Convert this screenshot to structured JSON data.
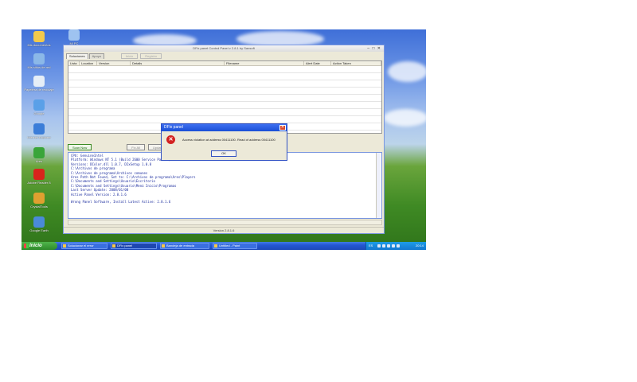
{
  "desktop": {
    "icons": [
      {
        "label": "Mis documentos",
        "icon": "documents-icon",
        "color": "#f2c94c"
      },
      {
        "label": "Mi PC",
        "icon": "computer-icon",
        "color": "#9ec3f0"
      },
      {
        "label": "Mis sitios de red",
        "icon": "network-icon",
        "color": "#8bb8e8"
      },
      {
        "label": "Papelera de reciclaje",
        "icon": "recycle-bin-icon",
        "color": "#e6eef7"
      },
      {
        "label": "Google",
        "icon": "browser-icon",
        "color": "#5aa0e8"
      },
      {
        "label": "Internet Explorer",
        "icon": "internet-explorer-icon",
        "color": "#3b7dd8"
      },
      {
        "label": "Ares",
        "icon": "ares-icon",
        "color": "#3aa53a"
      },
      {
        "label": "Adobe Reader 8",
        "icon": "adobe-reader-icon",
        "color": "#d8241c"
      },
      {
        "label": "CrystalTools",
        "icon": "tools-icon",
        "color": "#e0a030"
      },
      {
        "label": "Google Earth",
        "icon": "google-earth-icon",
        "color": "#4a8ad8"
      }
    ]
  },
  "app": {
    "title": "DFix panel Control Panel v 2.8.1 by Sansoft",
    "tabs": [
      {
        "label": "Soluciones"
      },
      {
        "label": "Apoyo"
      }
    ],
    "toolbar_buttons": [
      "Inicio",
      "Registro"
    ],
    "columns": [
      "Lista",
      "Location",
      "Version",
      "Details",
      "Filename",
      "Alert Date",
      "Action Taken"
    ],
    "actions": {
      "scan": "Scan Now",
      "fix": "Fix All",
      "update": "Update Now"
    },
    "log_lines": [
      "CPU: GenuineIntel",
      "Platform: Windows NT 5.1 (Build 2600 Service Pack 2)",
      "Versions: DColor.dll 1.0.7, DIxSetup 1.0.8",
      "C:\\Archivos de programa",
      "C:\\Archivos de programa\\Archivos comunes",
      "Ares Path Not Found, Set to: C:\\Archivos de programa\\Ares\\Players",
      "C:\\Documents and Settings\\Usuario\\Escritorio",
      "C:\\Documents and Settings\\Usuario\\Menú Inicio\\Programas",
      "Last Server Update: 2008/01/08",
      "Active Panel Version: 2.8.1.6",
      "",
      "Wrong Panel Software, Install Latest Active: 2.8.1.6"
    ],
    "status": "Version 2.8.1.6"
  },
  "dialog": {
    "title": "DFix panel",
    "message": "Access violation at address 00411100. Read of address 00411100",
    "ok_label": "OK",
    "close_glyph": "✕",
    "error_glyph": "✕"
  },
  "taskbar": {
    "start_label": "Inicio",
    "tasks": [
      {
        "label": "Solucionar el error",
        "active": false
      },
      {
        "label": "DFix panel",
        "active": true
      },
      {
        "label": "Bandeja de entrada",
        "active": false
      },
      {
        "label": "Untitled - Paint",
        "active": false
      }
    ],
    "language": "ES",
    "clock": "20:14"
  }
}
